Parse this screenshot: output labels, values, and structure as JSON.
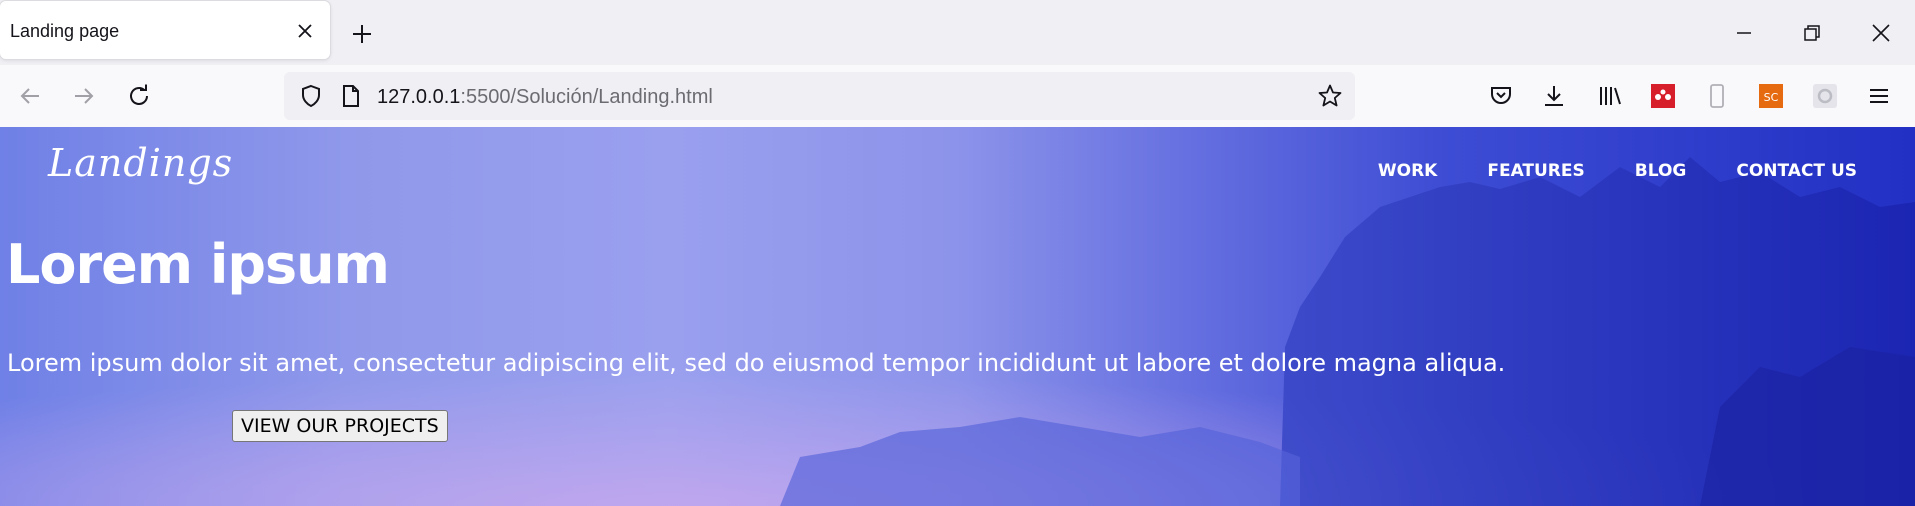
{
  "browser": {
    "tab_title": "Landing page",
    "url_host": "127.0.0.1",
    "url_path": ":5500/Solución/Landing.html"
  },
  "site": {
    "logo": "Landings",
    "nav": [
      "WORK",
      "FEATURES",
      "BLOG",
      "CONTACT US"
    ],
    "hero_title": "Lorem ipsum",
    "hero_text": "Lorem ipsum dolor sit amet, consectetur adipiscing elit, sed do eiusmod tempor incididunt ut labore et dolore magna aliqua.",
    "cta_label": "VIEW OUR PROJECTS"
  },
  "icons": {
    "tab_close": "close-icon",
    "new_tab": "plus-icon",
    "minimize": "minimize-icon",
    "restore": "restore-icon",
    "close_window": "close-icon",
    "back": "back-arrow-icon",
    "forward": "forward-arrow-icon",
    "reload": "reload-icon",
    "shield": "shield-icon",
    "page": "page-icon",
    "bookmark": "star-icon",
    "pocket": "pocket-icon",
    "downloads": "download-icon",
    "library": "library-icon",
    "extension_mendeley": "mendeley-icon",
    "extension_device": "phone-icon",
    "extension_sc": "sc-extension-icon",
    "extension_gear": "gear-extension-icon",
    "menu": "hamburger-menu-icon"
  },
  "colors": {
    "sc_badge": "#e66a10",
    "mendeley_badge": "#d71f2b",
    "hero_dark": "#2230c4",
    "hero_light": "#9aa0ee"
  }
}
